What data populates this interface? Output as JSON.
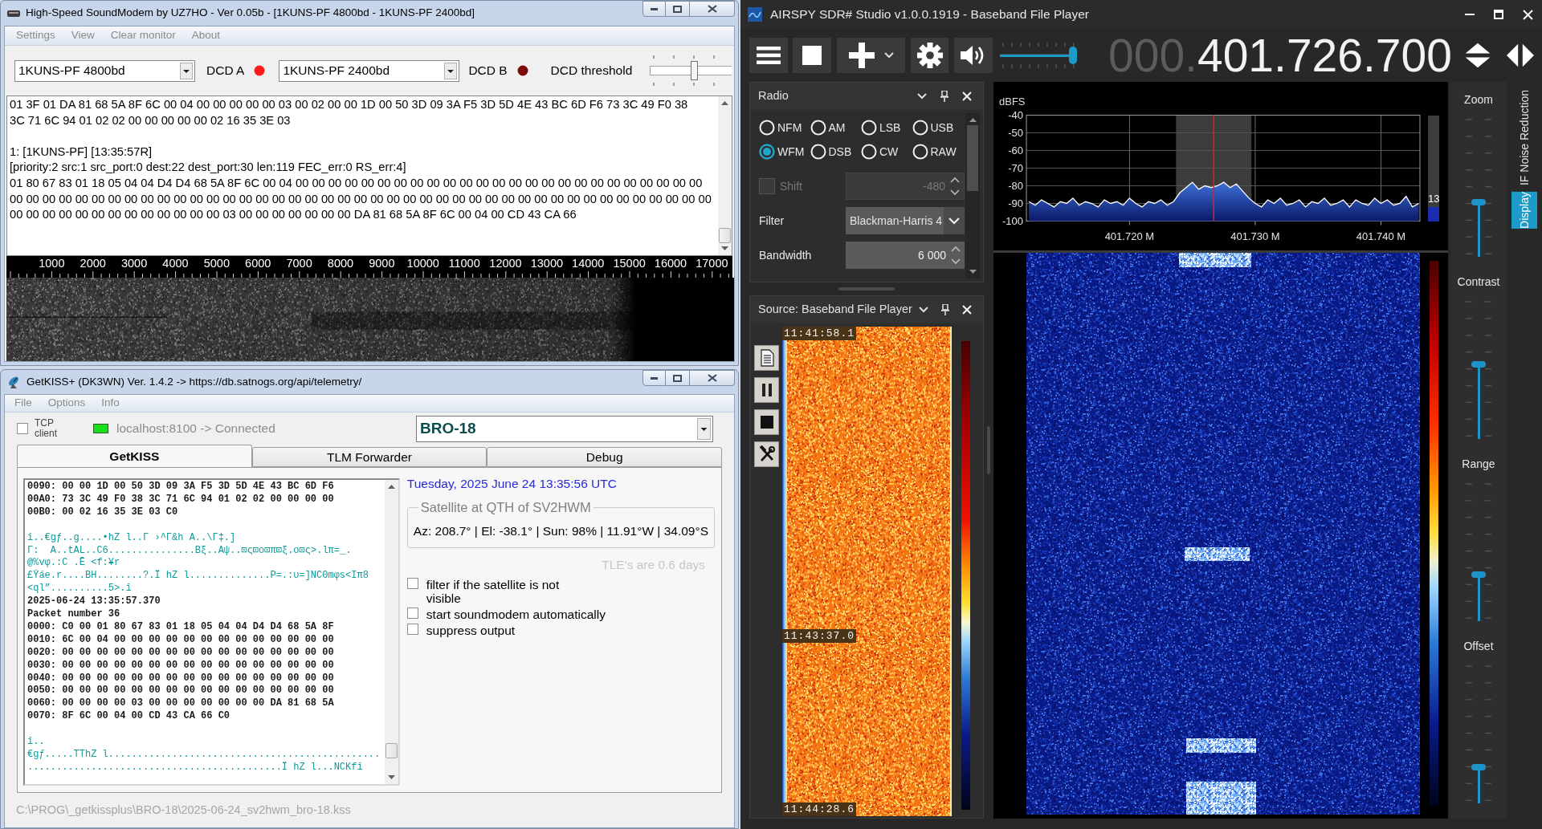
{
  "soundmodem": {
    "window": {
      "title": "High-Speed SoundModem by UZ7HO - Ver 0.05b - [1KUNS-PF 4800bd - 1KUNS-PF 2400bd]"
    },
    "menu": [
      "Settings",
      "View",
      "Clear monitor",
      "About"
    ],
    "modem_a": {
      "value": "1KUNS-PF 4800bd",
      "dcd_label": "DCD A",
      "dcd_on": true
    },
    "modem_b": {
      "value": "1KUNS-PF 2400bd",
      "dcd_label": "DCD B",
      "dcd_on": false
    },
    "dcd_threshold": {
      "label": "DCD threshold",
      "level": 0.55
    },
    "monitor": [
      [
        "01 3F 01 DA 81 68 5A 8F 6C 00 04 00 00 00 00 00 03 00 02 00 00 1D 00 50 3D 09 3A F5 3D 5D 4E 43 BC 6D F6 73 3C 49 F0 38",
        "3C 71 6C 94 01 02 02 00 00 00 00 00 02 16 35 3E 03"
      ],
      [
        "1: [1KUNS-PF] [13:35:57R]",
        "[priority:2 src:1 src_port:0 dest:22 dest_port:30 len:119 FEC_err:0 RS_err:4]",
        "01 80 67 83 01 18 05 04 04 D4 D4 68 5A 8F 6C 00 04 00 00 00 00 00 00 00 00 00 00 00 00 00 00 00 00 00 00 00 00 00 00 00 00 00",
        "00 00 00 00 00 00 00 00 00 00 00 00 00 00 00 00 00 00 00 00 00 00 00 00 00 00 00 00 00 00 00 00 00 00 00 00 00 00 00 00 00 00 00",
        "00 00 00 00 00 00 00 00 00 00 00 00 00 03 00 00 00 00 00 00 00 DA 81 68 5A 8F 6C 00 04 00 CD 43 CA 66"
      ]
    ],
    "ruler": [
      "1000",
      "2000",
      "3000",
      "4000",
      "5000",
      "6000",
      "7000",
      "8000",
      "9000",
      "10000",
      "11000",
      "12000",
      "13000",
      "14000",
      "15000",
      "16000",
      "17000"
    ]
  },
  "getkiss": {
    "window": {
      "title": "GetKISS+ (DK3WN) Ver. 1.4.2 -> https://db.satnogs.org/api/telemetry/"
    },
    "menu": [
      "File",
      "Options",
      "Info"
    ],
    "tcp_client": {
      "label": "TCP client",
      "checked": false
    },
    "connection": {
      "text": "localhost:8100 -> Connected",
      "connected": true
    },
    "satellite": {
      "value": "BRO-18"
    },
    "tabs": [
      {
        "label": "GetKISS",
        "selected": true
      },
      {
        "label": "TLM Forwarder",
        "selected": false
      },
      {
        "label": "Debug",
        "selected": false
      }
    ],
    "log": [
      {
        "kind": "hex",
        "lines": [
          "0090: 00 00 1D 00 50 3D 09 3A F5 3D 5D 4E 43 BC 6D F6",
          "00A0: 73 3C 49 F0 38 3C 71 6C 94 01 02 02 00 00 00 00",
          "00B0: 00 02 16 35 3E 03 C0"
        ]
      },
      {
        "kind": "ascii",
        "lines": [
          "î..€gƒ..g....•hZ l..Г ›^Г&h A..\\Г‡.]",
          "Г:  A..tAL..C6...............Bξ..Aψ..⊡ς⊡o⊡π⊡ξ.o⊡ς>.lπ=_.",
          "@%vφ.:C .Ē <f:¥r",
          "£Ÿáe.r....BH........?.Ï hZ l..............P=.:υ=]NCΘmφs<Iπ8",
          "<ql”..........5>.î"
        ]
      },
      {
        "kind": "hex",
        "lines": [
          "2025-06-24 13:35:57.370",
          "Packet number 36",
          "0000: C0 00 01 80 67 83 01 18 05 04 04 D4 D4 68 5A 8F",
          "0010: 6C 00 04 00 00 00 00 00 00 00 00 00 00 00 00 00",
          "0020: 00 00 00 00 00 00 00 00 00 00 00 00 00 00 00 00",
          "0030: 00 00 00 00 00 00 00 00 00 00 00 00 00 00 00 00",
          "0040: 00 00 00 00 00 00 00 00 00 00 00 00 00 00 00 00",
          "0050: 00 00 00 00 00 00 00 00 00 00 00 00 00 00 00 00",
          "0060: 00 00 00 00 03 00 00 00 00 00 00 00 DA 81 68 5A",
          "0070: 8F 6C 00 04 00 CD 43 CA 66 C0"
        ]
      },
      {
        "kind": "ascii",
        "lines": [
          "î..",
          "€gƒ.....TThZ l...............................................",
          "............................................Ï hZ l...NCKfî"
        ]
      }
    ],
    "date": "Tuesday, 2025 June 24  13:35:56 UTC",
    "qth": {
      "title": "Satellite at QTH of SV2HWM",
      "text": "Az: 208.7° | El: -38.1° | Sun: 98% | 11.91°W | 34.09°S"
    },
    "tle_age": "TLE's are 0.6 days",
    "options": [
      {
        "label": "filter if the satellite is not visible",
        "checked": false
      },
      {
        "label": "start soundmodem automatically",
        "checked": false
      },
      {
        "label": "suppress output",
        "checked": false
      }
    ],
    "status": "C:\\PROG\\_getkissplus\\BRO-18\\2025-06-24_sv2hwm_bro-18.kss"
  },
  "sdr": {
    "window": {
      "title": "AIRSPY SDR# Studio v1.0.0.1919 - Baseband File Player"
    },
    "volume": {
      "level": 0.95
    },
    "frequency": {
      "leading": "000.",
      "value": "401.726.700"
    },
    "radio": {
      "title": "Radio",
      "modes": [
        {
          "label": "NFM",
          "selected": false
        },
        {
          "label": "AM",
          "selected": false
        },
        {
          "label": "LSB",
          "selected": false
        },
        {
          "label": "USB",
          "selected": false
        },
        {
          "label": "WFM",
          "selected": true
        },
        {
          "label": "DSB",
          "selected": false
        },
        {
          "label": "CW",
          "selected": false
        },
        {
          "label": "RAW",
          "selected": false
        }
      ],
      "shift": {
        "label": "Shift",
        "checked": false,
        "disabled": true,
        "value": "-480"
      },
      "filter": {
        "label": "Filter",
        "value": "Blackman-Harris 4"
      },
      "bandwidth": {
        "label": "Bandwidth",
        "value": "6 000"
      }
    },
    "source": {
      "title": "Source: Baseband File Player",
      "timestamps": [
        "11:41:58.1",
        "11:43:37.0",
        "11:44:28.6"
      ]
    },
    "spectrum": {
      "chart_data": {
        "type": "line",
        "ylabel": "dBFS",
        "x": [
          401.712,
          401.7125,
          401.713,
          401.7135,
          401.714,
          401.7145,
          401.715,
          401.7155,
          401.716,
          401.7165,
          401.717,
          401.7175,
          401.718,
          401.7185,
          401.719,
          401.7195,
          401.72,
          401.7205,
          401.721,
          401.7215,
          401.722,
          401.7225,
          401.723,
          401.7235,
          401.724,
          401.7245,
          401.725,
          401.7255,
          401.726,
          401.7265,
          401.727,
          401.7275,
          401.728,
          401.7285,
          401.729,
          401.7295,
          401.73,
          401.7305,
          401.731,
          401.7315,
          401.732,
          401.7325,
          401.733,
          401.7335,
          401.734,
          401.7345,
          401.735,
          401.7355,
          401.736,
          401.7365,
          401.737,
          401.7375,
          401.738,
          401.7385,
          401.739,
          401.7395,
          401.74,
          401.7405,
          401.741,
          401.7415,
          401.742,
          401.7425,
          401.743
        ],
        "values": [
          -89,
          -91,
          -88,
          -90,
          -92,
          -89,
          -90,
          -87,
          -91,
          -89,
          -90,
          -92,
          -88,
          -90,
          -89,
          -91,
          -87,
          -90,
          -92,
          -89,
          -90,
          -88,
          -91,
          -89,
          -84,
          -81,
          -78,
          -82,
          -80,
          -81,
          -80,
          -78,
          -81,
          -79,
          -83,
          -87,
          -90,
          -92,
          -88,
          -90,
          -87,
          -91,
          -90,
          -88,
          -92,
          -89,
          -90,
          -87,
          -91,
          -90,
          -88,
          -92,
          -88,
          -90,
          -91,
          -87,
          -90,
          -88,
          -91,
          -90,
          -86,
          -92,
          -90
        ],
        "xlim": [
          401.7118,
          401.7431
        ],
        "ylim": [
          -100,
          -40
        ],
        "xticks": [
          {
            "value": 401.72,
            "label": "401.720 M"
          },
          {
            "value": 401.73,
            "label": "401.730 M"
          },
          {
            "value": 401.74,
            "label": "401.740 M"
          }
        ],
        "yticks": [
          -40,
          -50,
          -60,
          -70,
          -80,
          -90,
          -100
        ],
        "grid": true,
        "bands": [
          {
            "axis": "x",
            "from": 401.7237,
            "to": 401.7297
          }
        ],
        "ref_lines": [
          {
            "axis": "x",
            "value": 401.7267,
            "color": "#e02020"
          }
        ]
      },
      "snr": {
        "reading": "13",
        "level": 0.13
      }
    },
    "display_controls": [
      {
        "label": "Zoom",
        "level": 0.39
      },
      {
        "label": "Contrast",
        "level": 0.53
      },
      {
        "label": "Range",
        "level": 0.33
      },
      {
        "label": "Offset",
        "level": 0.26
      }
    ],
    "side_tabs": [
      {
        "label": "IF Noise Reduction",
        "selected": false
      },
      {
        "label": "Display",
        "selected": true
      }
    ]
  }
}
